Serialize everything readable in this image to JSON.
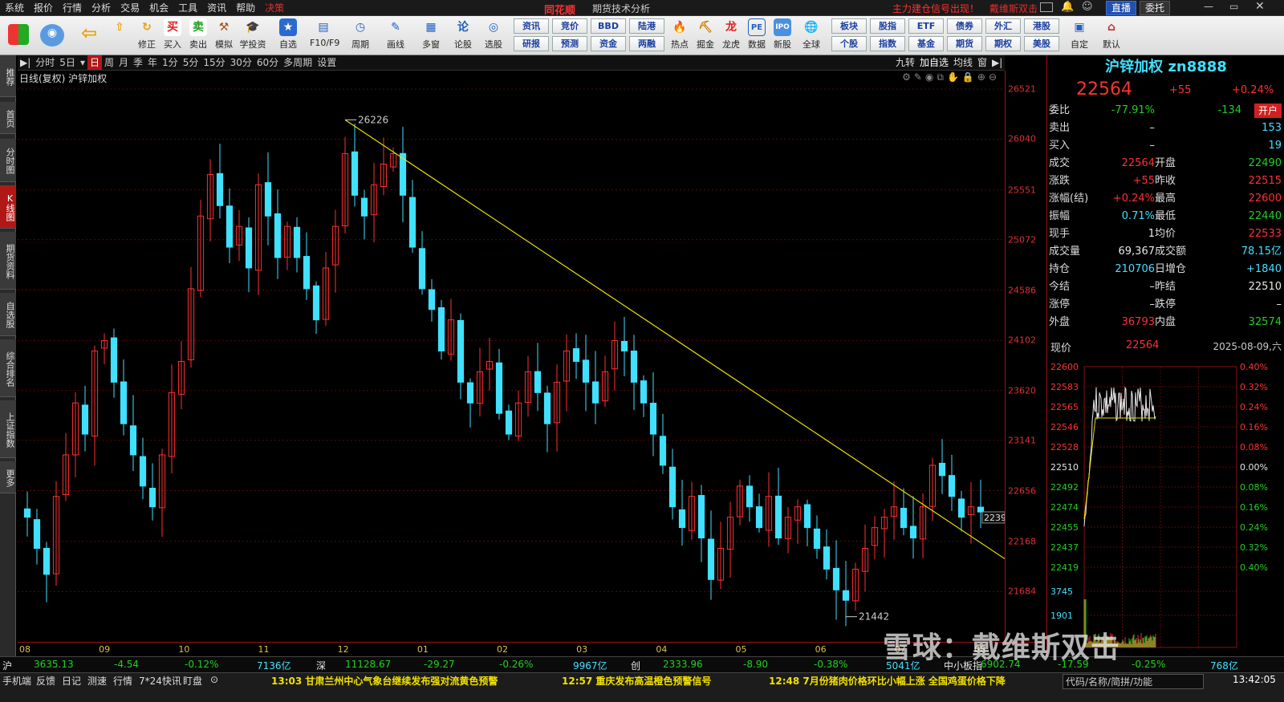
{
  "menu": {
    "items": [
      "系统",
      "报价",
      "行情",
      "分析",
      "交易",
      "机会",
      "工具",
      "资讯",
      "帮助",
      "决策"
    ],
    "brand": "同花顺",
    "subtitle": "期货技术分析",
    "signal_text": "主力建仓信号出现！",
    "ad_text": "戴维斯双击",
    "btn_live": "直播",
    "btn_weituo": "委托"
  },
  "toolbar": {
    "buttons": [
      "修正",
      "买入",
      "卖出",
      "模拟",
      "学投资",
      "自选",
      "F10/F9",
      "周期",
      "画线",
      "多窗",
      "论股",
      "选股",
      "热点",
      "掘金",
      "龙虎",
      "数据",
      "新股",
      "全球",
      "自定",
      "默认"
    ],
    "grid": [
      [
        "资讯",
        "竞价",
        "BBD",
        "陆港",
        "板块",
        "股指",
        "ETF",
        "债券",
        "外汇",
        "港股"
      ],
      [
        "研报",
        "预测",
        "资金",
        "两融",
        "个股",
        "指数",
        "基金",
        "期货",
        "期权",
        "美股"
      ]
    ]
  },
  "left_tabs": [
    "推荐",
    "首页",
    "分时图",
    "K线图",
    "期货资料",
    "自选股",
    "综合排名",
    "上证指数",
    "更多"
  ],
  "period_bar": {
    "items": [
      "分时",
      "5日",
      "日",
      "周",
      "月",
      "季",
      "年",
      "1分",
      "5分",
      "15分",
      "30分",
      "60分",
      "多周期",
      "设置"
    ],
    "active": "日",
    "right": [
      "九转",
      "加自选",
      "均线",
      "窗"
    ]
  },
  "chart_header": "日线(复权)  沪锌加权",
  "chart_data": {
    "type": "candlestick",
    "instrument": "沪锌加权",
    "period": "日线(复权)",
    "ylim": [
      21200,
      26700
    ],
    "yticks": [
      26521,
      26040,
      25551,
      25072,
      24586,
      24102,
      23620,
      23141,
      22656,
      22168,
      21684
    ],
    "xticks": [
      "08",
      "09",
      "10",
      "11",
      "12",
      "01",
      "02",
      "03",
      "04",
      "05",
      "06",
      "07",
      "08"
    ],
    "annotations": {
      "high": 26226,
      "low": 21442,
      "last": "2239"
    },
    "trendline": {
      "from": {
        "date": "12",
        "value": 26226
      },
      "to": {
        "date": "08",
        "value": 22000
      }
    },
    "closes": [
      22400,
      22100,
      21850,
      22600,
      23000,
      23500,
      23200,
      24000,
      24100,
      23700,
      23300,
      23000,
      22700,
      22500,
      23000,
      23600,
      23900,
      24600,
      25300,
      25700,
      25400,
      25000,
      25200,
      24800,
      25600,
      25300,
      24900,
      25200,
      24900,
      24600,
      24300,
      24800,
      25200,
      25900,
      25500,
      25300,
      25600,
      25800,
      25900,
      25500,
      25000,
      24600,
      24400,
      24000,
      24300,
      23700,
      23500,
      23800,
      23900,
      23400,
      23200,
      23500,
      23800,
      23600,
      23300,
      23700,
      24000,
      23900,
      23700,
      23500,
      23800,
      24100,
      24000,
      23700,
      23500,
      23200,
      22900,
      22500,
      22300,
      22600,
      22200,
      21800,
      22100,
      22400,
      22700,
      22500,
      22300,
      22600,
      22200,
      22400,
      22500,
      22300,
      22100,
      21900,
      21700,
      21600,
      21900,
      22100,
      22300,
      22400,
      22500,
      22300,
      22200,
      22500,
      22900,
      22800,
      22600,
      22400,
      22500,
      22450
    ],
    "x_ticks_note": "months"
  },
  "quote": {
    "title": "沪锌加权 zn8888",
    "price": "22564",
    "change": "+55",
    "change_pct": "+0.24%",
    "rows": [
      {
        "k": "委比",
        "v1": "-77.91%",
        "v1c": "green",
        "k2": "",
        "v2": "-134",
        "v2c": "green",
        "btn": "开户"
      },
      {
        "k": "卖出",
        "v1": "–",
        "v1c": "white",
        "k2": "",
        "v2": "153",
        "v2c": "cyan"
      },
      {
        "k": "买入",
        "v1": "–",
        "v1c": "white",
        "k2": "",
        "v2": "19",
        "v2c": "cyan"
      },
      {
        "k": "成交",
        "v1": "22564",
        "v1c": "red",
        "k2": "开盘",
        "v2": "22490",
        "v2c": "green"
      },
      {
        "k": "涨跌",
        "v1": "+55",
        "v1c": "red",
        "k2": "昨收",
        "v2": "22515",
        "v2c": "red"
      },
      {
        "k": "涨幅(结)",
        "v1": "+0.24%",
        "v1c": "red",
        "k2": "最高",
        "v2": "22600",
        "v2c": "red"
      },
      {
        "k": "振幅",
        "v1": "0.71%",
        "v1c": "cyan",
        "k2": "最低",
        "v2": "22440",
        "v2c": "green"
      },
      {
        "k": "现手",
        "v1": "1",
        "v1c": "white",
        "k2": "均价",
        "v2": "22533",
        "v2c": "red"
      },
      {
        "k": "成交量",
        "v1": "69,367",
        "v1c": "white",
        "k2": "成交额",
        "v2": "78.15亿",
        "v2c": "cyan"
      },
      {
        "k": "持仓",
        "v1": "210706",
        "v1c": "cyan",
        "k2": "日增仓",
        "v2": "+1840",
        "v2c": "cyan"
      },
      {
        "k": "今结",
        "v1": "–",
        "v1c": "white",
        "k2": "昨结",
        "v2": "22510",
        "v2c": "white"
      },
      {
        "k": "涨停",
        "v1": "–",
        "v1c": "white",
        "k2": "跌停",
        "v2": "–",
        "v2c": "white"
      },
      {
        "k": "外盘",
        "v1": "36793",
        "v1c": "red",
        "k2": "内盘",
        "v2": "32574",
        "v2c": "green"
      }
    ],
    "mini": {
      "label": "现价",
      "price": "22564",
      "date": "2025-08-09,六",
      "y_labels": [
        "22600",
        "22583",
        "22565",
        "22546",
        "22528",
        "22510",
        "22492",
        "22474",
        "22455",
        "22437",
        "22419"
      ],
      "pct_labels": [
        "0.40%",
        "0.32%",
        "0.24%",
        "0.16%",
        "0.08%",
        "0.00%",
        "0.08%",
        "0.16%",
        "0.24%",
        "0.32%",
        "0.40%"
      ],
      "vol_labels": [
        "3745",
        "1901"
      ]
    }
  },
  "status": [
    {
      "t": "沪",
      "c": "white"
    },
    {
      "t": "3635.13",
      "c": "green"
    },
    {
      "t": "-4.54",
      "c": "green"
    },
    {
      "t": "-0.12%",
      "c": "green"
    },
    {
      "t": "7136亿",
      "c": "cyan"
    },
    {
      "t": "深",
      "c": "white"
    },
    {
      "t": "11128.67",
      "c": "green"
    },
    {
      "t": "-29.27",
      "c": "green"
    },
    {
      "t": "-0.26%",
      "c": "green"
    },
    {
      "t": "9967亿",
      "c": "cyan"
    },
    {
      "t": "创",
      "c": "white"
    },
    {
      "t": "2333.96",
      "c": "green"
    },
    {
      "t": "-8.90",
      "c": "green"
    },
    {
      "t": "-0.38%",
      "c": "green"
    },
    {
      "t": "5041亿",
      "c": "cyan"
    },
    {
      "t": "中小板指",
      "c": "white"
    },
    {
      "t": "6902.74",
      "c": "green"
    },
    {
      "t": "-17.59",
      "c": "green"
    },
    {
      "t": "-0.25%",
      "c": "green"
    },
    {
      "t": "768亿",
      "c": "cyan"
    }
  ],
  "bottom": {
    "tabs": [
      "手机端",
      "反馈",
      "日记",
      "测速",
      "行情",
      "7*24快讯",
      "盯盘"
    ],
    "news": [
      "13:03 甘肃兰州中心气象台继续发布强对流黄色预警",
      "12:57 重庆发布高温橙色预警信号",
      "12:48 7月份猪肉价格环比小幅上涨 全国鸡蛋价格下降"
    ],
    "search": "代码/名称/简拼/功能",
    "clock": "13:42:05"
  },
  "watermark": "雪球：戴维斯双击"
}
